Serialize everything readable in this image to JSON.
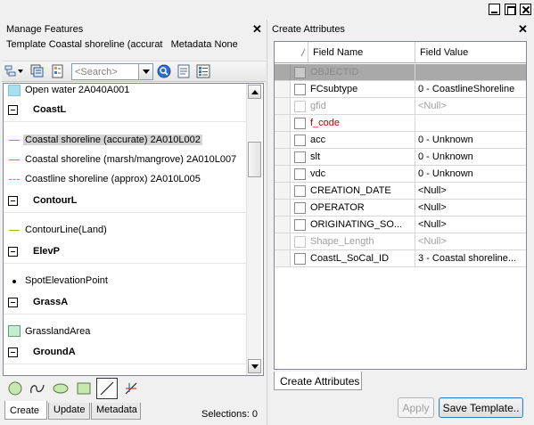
{
  "colors": {
    "panel_bg": "#f0f0f0",
    "selected_item_bg": "#d4d4d4",
    "highlight_row_bg": "#a9a9a9",
    "required_field_red": "#c00000",
    "line_cyan": "#2eb8d6",
    "line_olive": "#a0b040",
    "water_fill": "#a7dff2",
    "grass_fill": "#c4eed0"
  },
  "window_controls": [
    "minimize-icon",
    "maximize-icon",
    "close-icon"
  ],
  "left_panel": {
    "title": "Manage Features",
    "template_label": "Template",
    "template_value": "Coastal shoreline (accurat",
    "metadata_label": "Metadata",
    "metadata_value": "None",
    "search": {
      "placeholder": "<Search>"
    },
    "toolbar_icons": [
      "organize-templates-icon",
      "create-template-icon",
      "properties-icon",
      "search-icon",
      "metadata-icon",
      "view-list-icon"
    ],
    "list": {
      "partial_item": {
        "label": "Open water 2A040A001",
        "symbol": "polygon-water"
      },
      "groups": [
        {
          "name": "CoastL",
          "items": [
            {
              "label": "Coastal shoreline (accurate) 2A010L002",
              "symbol": "line-cyan",
              "selected": true
            },
            {
              "label": "Coastal shoreline (marsh/mangrove) 2A010L007",
              "symbol": "line-cyan",
              "selected": false
            },
            {
              "label": "Coastline shoreline (approx) 2A010L005",
              "symbol": "line-cyan-dashed",
              "selected": false
            }
          ]
        },
        {
          "name": "ContourL",
          "items": [
            {
              "label": "ContourLine(Land)",
              "symbol": "line-olive",
              "selected": false
            }
          ]
        },
        {
          "name": "ElevP",
          "items": [
            {
              "label": "SpotElevationPoint",
              "symbol": "point",
              "selected": false
            }
          ]
        },
        {
          "name": "GrassA",
          "items": [
            {
              "label": "GrasslandArea",
              "symbol": "polygon-grass",
              "selected": false
            }
          ]
        },
        {
          "name": "GroundA",
          "items": []
        }
      ]
    },
    "construction_tools": [
      "circle-icon",
      "freehand-icon",
      "ellipse-icon",
      "rectangle-icon",
      "line-icon",
      "right-angle-icon"
    ],
    "active_tool": "line-icon",
    "tabs": [
      "Create",
      "Update",
      "Metadata"
    ],
    "active_tab": "Create",
    "selections_text": "Selections: 0"
  },
  "right_panel": {
    "title": "Create Attributes",
    "columns": [
      "Field Name",
      "Field Value"
    ],
    "rows": [
      {
        "name": "OBJECTID",
        "value": "",
        "style": "highlight"
      },
      {
        "name": "FCsubtype",
        "value": "0 - CoastlineShoreline",
        "style": "normal"
      },
      {
        "name": "gfid",
        "value": "<Null>",
        "style": "readonly"
      },
      {
        "name": "f_code",
        "value": "",
        "style": "required"
      },
      {
        "name": "acc",
        "value": "0 - Unknown",
        "style": "normal"
      },
      {
        "name": "slt",
        "value": "0 - Unknown",
        "style": "normal"
      },
      {
        "name": "vdc",
        "value": "0 - Unknown",
        "style": "normal"
      },
      {
        "name": "CREATION_DATE",
        "value": "<Null>",
        "style": "normal"
      },
      {
        "name": "OPERATOR",
        "value": "<Null>",
        "style": "normal"
      },
      {
        "name": "ORIGINATING_SO...",
        "value": "<Null>",
        "style": "normal"
      },
      {
        "name": "Shape_Length",
        "value": "<Null>",
        "style": "readonly"
      },
      {
        "name": "CoastL_SoCal_ID",
        "value": "3 - Coastal shoreline...",
        "style": "normal"
      }
    ],
    "tab": "Create Attributes",
    "buttons": {
      "apply": {
        "label": "Apply",
        "enabled": false
      },
      "save_template": {
        "label": "Save Template..",
        "enabled": true
      }
    }
  }
}
